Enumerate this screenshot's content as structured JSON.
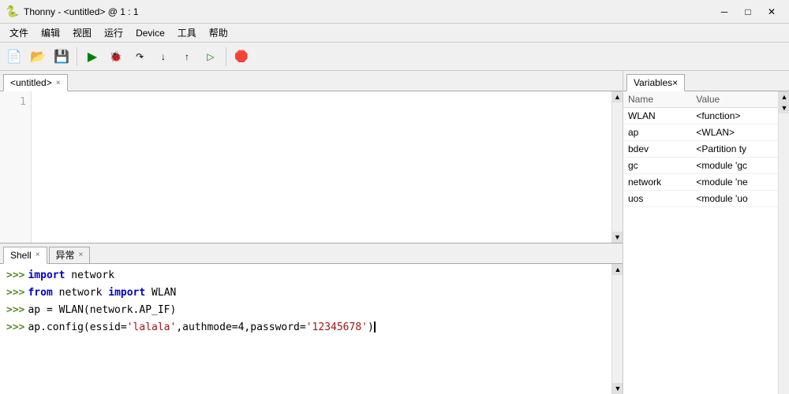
{
  "titlebar": {
    "icon": "🐍",
    "title": "Thonny  -  <untitled>  @  1 : 1",
    "minimize": "─",
    "maximize": "□",
    "close": "✕"
  },
  "menubar": {
    "items": [
      "文件",
      "编辑",
      "视图",
      "运行",
      "Device",
      "工具",
      "帮助"
    ]
  },
  "toolbar": {
    "buttons": [
      {
        "name": "new-btn",
        "icon": "📄"
      },
      {
        "name": "open-btn",
        "icon": "📂"
      },
      {
        "name": "save-btn",
        "icon": "💾"
      },
      {
        "name": "run-btn",
        "icon": "▶"
      },
      {
        "name": "debug-btn",
        "icon": "🐞"
      },
      {
        "name": "step-over-btn",
        "icon": "↷"
      },
      {
        "name": "step-into-btn",
        "icon": "↓"
      },
      {
        "name": "step-out-btn",
        "icon": "↑"
      },
      {
        "name": "resume-btn",
        "icon": "▷"
      },
      {
        "name": "stop-btn",
        "icon": "⛔"
      }
    ]
  },
  "editor": {
    "tab_label": "<untitled>",
    "tab_close": "×",
    "line_numbers": [
      "1"
    ],
    "code_lines": []
  },
  "shell": {
    "tab_label": "Shell",
    "tab_close": "×",
    "tab2_label": "异常",
    "tab2_close": "×",
    "lines": [
      {
        "prompt": ">>>",
        "parts": [
          {
            "type": "kw",
            "text": "import"
          },
          {
            "type": "normal",
            "text": " network"
          }
        ]
      },
      {
        "prompt": ">>>",
        "parts": [
          {
            "type": "kw",
            "text": "from"
          },
          {
            "type": "normal",
            "text": " network "
          },
          {
            "type": "kw",
            "text": "import"
          },
          {
            "type": "normal",
            "text": " WLAN"
          }
        ]
      },
      {
        "prompt": ">>>",
        "parts": [
          {
            "type": "normal",
            "text": "ap = WLAN(network.AP_IF)"
          }
        ]
      },
      {
        "prompt": ">>>",
        "parts": [
          {
            "type": "normal",
            "text": "ap.config(essid="
          },
          {
            "type": "str",
            "text": "'lalala'"
          },
          {
            "type": "normal",
            "text": ",authmode=4,password="
          },
          {
            "type": "str",
            "text": "'12345678'"
          },
          {
            "type": "normal",
            "text": ")"
          }
        ]
      }
    ]
  },
  "variables": {
    "tab_label": "Variables",
    "tab_close": "×",
    "col_name": "Name",
    "col_value": "Value",
    "rows": [
      {
        "name": "WLAN",
        "value": "<function>"
      },
      {
        "name": "ap",
        "value": "<WLAN>"
      },
      {
        "name": "bdev",
        "value": "<Partition ty"
      },
      {
        "name": "gc",
        "value": "<module 'gc"
      },
      {
        "name": "network",
        "value": "<module 'ne"
      },
      {
        "name": "uos",
        "value": "<module 'uo"
      }
    ]
  }
}
